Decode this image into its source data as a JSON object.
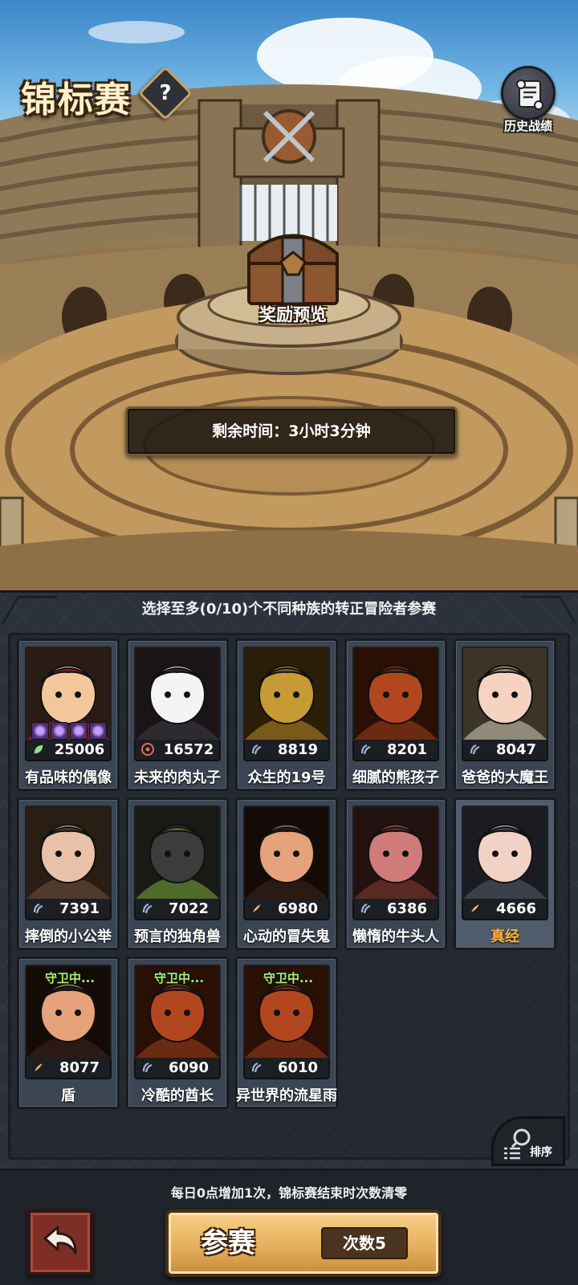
{
  "header": {
    "title": "锦标赛",
    "help_glyph": "?",
    "history_label": "历史战绩"
  },
  "reward": {
    "label": "奖励预览"
  },
  "timer": {
    "text": "剩余时间：3小时3分钟"
  },
  "panel": {
    "instruction": "选择至多(0/10)个不同种族的转正冒险者参赛",
    "sort_label": "排序"
  },
  "cards": [
    {
      "name": "有品味的偶像",
      "power": "25006",
      "stat_icon": "leaf-icon",
      "runes": 4
    },
    {
      "name": "未来的肉丸子",
      "power": "16572",
      "stat_icon": "target-icon"
    },
    {
      "name": "众生的19号",
      "power": "8819",
      "stat_icon": "claw-icon"
    },
    {
      "name": "细腻的熊孩子",
      "power": "8201",
      "stat_icon": "claw-icon"
    },
    {
      "name": "爸爸的大魔王",
      "power": "8047",
      "stat_icon": "claw-icon"
    },
    {
      "name": "摔倒的小公举",
      "power": "7391",
      "stat_icon": "claw-icon"
    },
    {
      "name": "预言的独角兽",
      "power": "7022",
      "stat_icon": "claw-icon"
    },
    {
      "name": "心动的冒失鬼",
      "power": "6980",
      "stat_icon": "quill-icon"
    },
    {
      "name": "懒惰的牛头人",
      "power": "6386",
      "stat_icon": "claw-icon"
    },
    {
      "name": "真经",
      "power": "4666",
      "stat_icon": "quill-icon",
      "highlight": true
    },
    {
      "name": "盾",
      "power": "8077",
      "stat_icon": "quill-icon",
      "status": "守卫中..."
    },
    {
      "name": "冷酷的酋长",
      "power": "6090",
      "stat_icon": "claw-icon",
      "status": "守卫中..."
    },
    {
      "name": "异世界的流星雨",
      "power": "6010",
      "stat_icon": "claw-icon",
      "status": "守卫中..."
    }
  ],
  "footer": {
    "note": "每日0点增加1次，锦标赛结束时次数清零",
    "join_label": "参赛",
    "count_label": "次数5"
  },
  "colors": {
    "highlight_name": "#ffb43b",
    "guard_status": "#a8f06a",
    "join_button": "#e6b05c",
    "back_button": "#7d2f26"
  }
}
